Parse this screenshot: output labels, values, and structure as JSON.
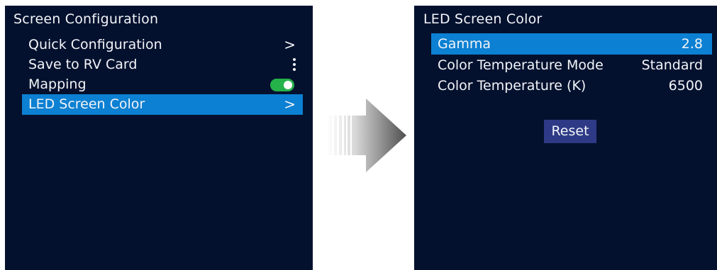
{
  "left_screen": {
    "title": "Screen Configuration",
    "items": [
      {
        "label": "Quick Configuration",
        "indicator": ">"
      },
      {
        "label": "Save to RV Card",
        "indicator": "more-vertical-icon"
      },
      {
        "label": "Mapping",
        "indicator": "toggle",
        "toggle_on": true
      },
      {
        "label": "LED Screen Color",
        "indicator": ">",
        "selected": true
      }
    ]
  },
  "right_screen": {
    "title": "LED Screen Color",
    "rows": [
      {
        "label": "Gamma",
        "value": "2.8",
        "selected": true
      },
      {
        "label": "Color Temperature Mode",
        "value": "Standard"
      },
      {
        "label": "Color Temperature (K)",
        "value": "6500"
      }
    ],
    "reset_label": "Reset"
  },
  "colors": {
    "panel_background": "#04112e",
    "highlight": "#0c80d2",
    "toggle_on": "#25b24a",
    "button": "#2e3a86",
    "text": "#f2f4f8"
  }
}
